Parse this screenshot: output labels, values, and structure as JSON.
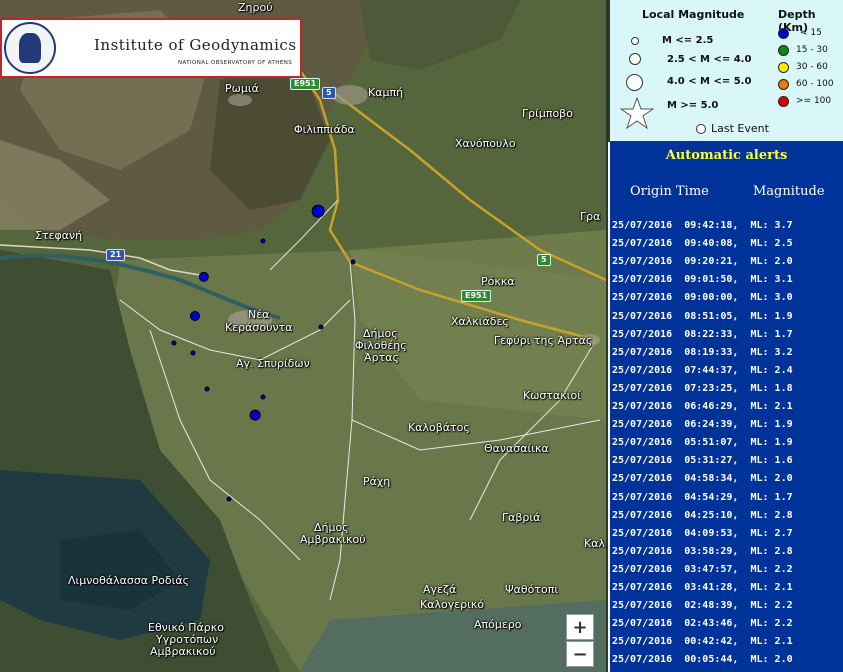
{
  "map": {
    "places": [
      {
        "name": "Ζηρού"
      },
      {
        "name": "Ρωμιά"
      },
      {
        "name": "Καμπή"
      },
      {
        "name": "Γρίμποβο"
      },
      {
        "name": "Φιλιππιάδα"
      },
      {
        "name": "Χανόπουλο"
      },
      {
        "name": "Στεφανή"
      },
      {
        "name": "Ρόκκα"
      },
      {
        "name": "Χαλκιάδες"
      },
      {
        "name": "Νέα"
      },
      {
        "name": "Κεράσουντα"
      },
      {
        "name": "Δήμος"
      },
      {
        "name": "Φιλοθέης"
      },
      {
        "name": "Άρτας"
      },
      {
        "name": "Γεφύρι της Άρτας"
      },
      {
        "name": "Αγ. Σπυρίδων"
      },
      {
        "name": "Κωστακιοί"
      },
      {
        "name": "Καλοβάτος"
      },
      {
        "name": "Θανασαίικα"
      },
      {
        "name": "Ράχη"
      },
      {
        "name": "Γαβριά"
      },
      {
        "name": "Δήμος"
      },
      {
        "name": "Αμβρακικού"
      },
      {
        "name": "Λιμνοθάλασσα Ροδιάς"
      },
      {
        "name": "Αγεζά"
      },
      {
        "name": "Ψαθότοπι"
      },
      {
        "name": "Καλογερικό"
      },
      {
        "name": "Απόμερο"
      },
      {
        "name": "Εθνικό Πάρκο"
      },
      {
        "name": "Υγροτόπων"
      },
      {
        "name": "Αμβρακικού"
      },
      {
        "name": "Γρα"
      },
      {
        "name": "Καλ"
      }
    ],
    "road_shields": [
      "E951",
      "5",
      "21",
      "5",
      "E951"
    ],
    "events": [
      {
        "ml": 3.7,
        "depth_class": "< 15"
      },
      {
        "ml": 2.5,
        "depth_class": "< 15"
      },
      {
        "ml": 2.0,
        "depth_class": "< 15"
      },
      {
        "ml": 3.1,
        "depth_class": "< 15"
      },
      {
        "ml": 3.0,
        "depth_class": "< 15"
      },
      {
        "ml": 1.9,
        "depth_class": "< 15"
      },
      {
        "ml": 1.7,
        "depth_class": "< 15"
      },
      {
        "ml": 3.2,
        "depth_class": "< 15"
      },
      {
        "ml": 2.4,
        "depth_class": "< 15"
      },
      {
        "ml": 1.8,
        "depth_class": "< 15"
      },
      {
        "ml": 2.1,
        "depth_class": "< 15"
      },
      {
        "ml": 1.9,
        "depth_class": "< 15"
      }
    ],
    "zoom_in": "+",
    "zoom_out": "−"
  },
  "logo": {
    "title": "Institute of Geodynamics",
    "subtitle": "NATIONAL OBSERVATORY OF ATHENS"
  },
  "legend": {
    "magnitude_title": "Local Magnitude",
    "depth_title": "Depth (Km)",
    "magnitude_classes": [
      "M <= 2.5",
      "2.5 < M <= 4.0",
      "4.0 < M <= 5.0",
      "M >= 5.0"
    ],
    "depth_classes": [
      {
        "label": "< 15",
        "color": "#0000cc"
      },
      {
        "label": "15 - 30",
        "color": "#118811"
      },
      {
        "label": "30 - 60",
        "color": "#ffee00"
      },
      {
        "label": "60 - 100",
        "color": "#ee7700"
      },
      {
        "label": ">= 100",
        "color": "#dd0000"
      }
    ],
    "last_event": "Last Event"
  },
  "alerts": {
    "title": "Automatic alerts",
    "col_time": "Origin Time",
    "col_mag": "Magnitude",
    "rows": [
      "25/07/2016  09:42:18,  ML: 3.7",
      "25/07/2016  09:40:08,  ML: 2.5",
      "25/07/2016  09:20:21,  ML: 2.0",
      "25/07/2016  09:01:50,  ML: 3.1",
      "25/07/2016  09:00:00,  ML: 3.0",
      "25/07/2016  08:51:05,  ML: 1.9",
      "25/07/2016  08:22:33,  ML: 1.7",
      "25/07/2016  08:19:33,  ML: 3.2",
      "25/07/2016  07:44:37,  ML: 2.4",
      "25/07/2016  07:23:25,  ML: 1.8",
      "25/07/2016  06:46:29,  ML: 2.1",
      "25/07/2016  06:24:39,  ML: 1.9",
      "25/07/2016  05:51:07,  ML: 1.9",
      "25/07/2016  05:31:27,  ML: 1.6",
      "25/07/2016  04:58:34,  ML: 2.0",
      "25/07/2016  04:54:29,  ML: 1.7",
      "25/07/2016  04:25:10,  ML: 2.8",
      "25/07/2016  04:09:53,  ML: 2.7",
      "25/07/2016  03:58:29,  ML: 2.8",
      "25/07/2016  03:47:57,  ML: 2.2",
      "25/07/2016  03:41:28,  ML: 2.1",
      "25/07/2016  02:48:39,  ML: 2.2",
      "25/07/2016  02:43:46,  ML: 2.2",
      "25/07/2016  00:42:42,  ML: 2.1",
      "25/07/2016  00:05:44,  ML: 2.0"
    ]
  }
}
